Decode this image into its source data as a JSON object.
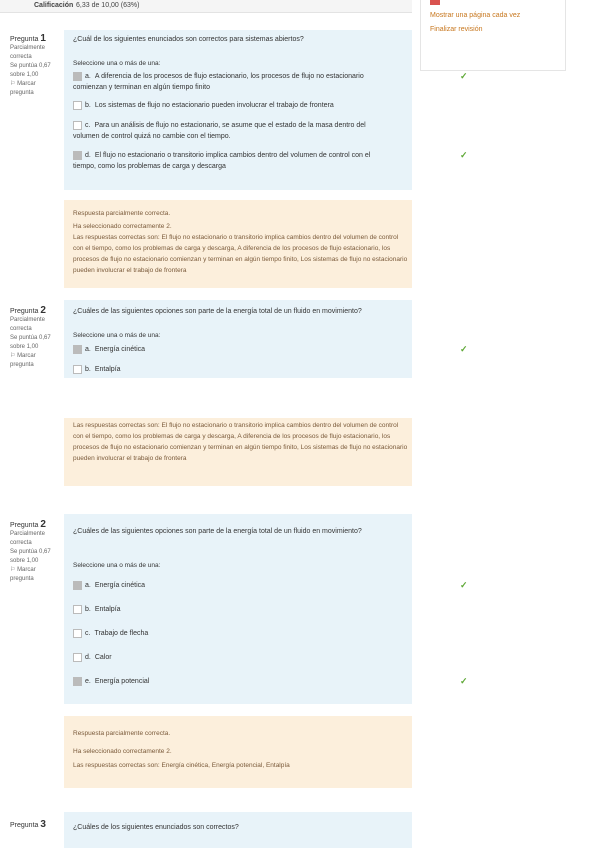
{
  "grade": {
    "label": "Calificación",
    "value": "6,33 de 10,00 (63%)"
  },
  "side_panel": {
    "show_one_page": "Mostrar una página cada vez",
    "finish_review": "Finalizar revisión"
  },
  "q1": {
    "number_prefix": "Pregunta",
    "number": "1",
    "status": "Parcialmente correcta",
    "score": "Se puntúa 0,67 sobre 1,00",
    "flag": "Marcar pregunta",
    "text": "¿Cuál de los siguientes enunciados son correctos para sistemas abiertos?",
    "prompt": "Seleccione una o más de una:",
    "options": [
      {
        "letter": "a.",
        "text": "A diferencia de los procesos de flujo estacionario, los procesos de flujo no estacionario comienzan y terminan en algún tiempo finito",
        "checked": true,
        "correct": true
      },
      {
        "letter": "b.",
        "text": "Los sistemas de flujo no estacionario pueden involucrar el trabajo de frontera",
        "checked": false,
        "correct": false
      },
      {
        "letter": "c.",
        "text": "Para un análisis de flujo no estacionario, se asume que el estado de la masa dentro del volumen de control quizá no cambie con el tiempo.",
        "checked": false,
        "correct": false
      },
      {
        "letter": "d.",
        "text": "El flujo no estacionario o transitorio implica cambios dentro del volumen de control con el tiempo, como los problemas de carga y descarga",
        "checked": true,
        "correct": true
      }
    ],
    "feedback": {
      "title": "Respuesta parcialmente correcta.",
      "selected": "Ha seleccionado correctamente 2.",
      "answer": "Las respuestas correctas son: El flujo no estacionario o transitorio implica cambios dentro del volumen de control con el tiempo, como los problemas de carga y descarga, A diferencia de los procesos de flujo estacionario, los procesos de flujo no estacionario comienzan y terminan en algún tiempo finito, Los sistemas de flujo no estacionario pueden involucrar el trabajo de frontera"
    }
  },
  "q2": {
    "number_prefix": "Pregunta",
    "number": "2",
    "status": "Parcialmente correcta",
    "score": "Se puntúa 0,67 sobre 1,00",
    "flag": "Marcar pregunta",
    "text": "¿Cuáles de las siguientes opciones son parte de la energía total de un fluido en movimiento?",
    "prompt": "Seleccione una o más de una:",
    "options": [
      {
        "letter": "a.",
        "text": "Energía cinética",
        "checked": true,
        "correct": true
      },
      {
        "letter": "b.",
        "text": "Entalpía",
        "checked": false,
        "correct": false
      },
      {
        "letter": "c.",
        "text": "Trabajo de flecha",
        "checked": false,
        "correct": false
      },
      {
        "letter": "d.",
        "text": "Calor",
        "checked": false,
        "correct": false
      },
      {
        "letter": "e.",
        "text": "Energía potencial",
        "checked": true,
        "correct": true
      }
    ],
    "feedback": {
      "title": "Respuesta parcialmente correcta.",
      "selected": "Ha seleccionado correctamente 2.",
      "answer": "Las respuestas correctas son: Energía cinética, Energía potencial, Entalpía"
    }
  },
  "q3": {
    "number_prefix": "Pregunta",
    "number": "3",
    "text": "¿Cuáles de los siguientes enunciados son correctos?"
  },
  "icons": [
    "notification-icon",
    "diamond-icon",
    "briefcase-icon",
    "chart-icon",
    "office-icon",
    "outlook-icon",
    "tree-icon",
    "search-icon",
    "minus-icon",
    "grid-icon",
    "settings-icon"
  ],
  "colors": {
    "question_bg": "#e8f3f9",
    "feedback_bg": "#fcefdc",
    "tick": "#5ea836",
    "link": "#c7771e"
  }
}
